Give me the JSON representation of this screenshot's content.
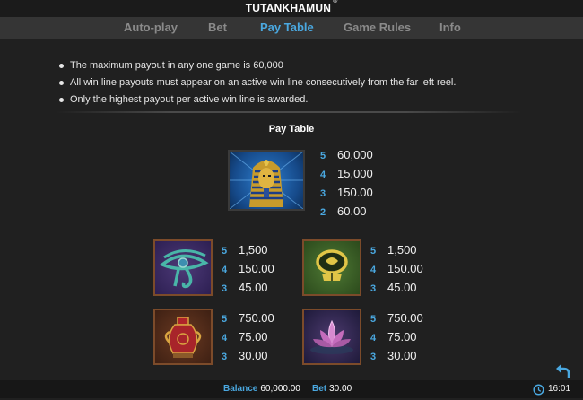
{
  "app": {
    "title": "TUTANKHAMUN",
    "mark": "®"
  },
  "tabs": [
    {
      "label": "Auto-play",
      "active": false
    },
    {
      "label": "Bet",
      "active": false
    },
    {
      "label": "Pay Table",
      "active": true
    },
    {
      "label": "Game Rules",
      "active": false
    },
    {
      "label": "Info",
      "active": false
    }
  ],
  "rules": [
    "The maximum payout in any one game is 60,000",
    "All win line payouts must appear on an active win line consecutively from the far left reel.",
    "Only the highest payout per active win line is awarded."
  ],
  "paytable": {
    "title": "Pay Table",
    "symbols": [
      {
        "icon": "pharaoh-mask-icon",
        "payouts": [
          {
            "count": "5",
            "amount": "60,000"
          },
          {
            "count": "4",
            "amount": "15,000"
          },
          {
            "count": "3",
            "amount": "150.00"
          },
          {
            "count": "2",
            "amount": "60.00"
          }
        ]
      },
      {
        "icon": "eye-of-horus-icon",
        "payouts": [
          {
            "count": "5",
            "amount": "1,500"
          },
          {
            "count": "4",
            "amount": "150.00"
          },
          {
            "count": "3",
            "amount": "45.00"
          }
        ]
      },
      {
        "icon": "scarab-amulet-icon",
        "payouts": [
          {
            "count": "5",
            "amount": "1,500"
          },
          {
            "count": "4",
            "amount": "150.00"
          },
          {
            "count": "3",
            "amount": "45.00"
          }
        ]
      },
      {
        "icon": "vase-icon",
        "payouts": [
          {
            "count": "5",
            "amount": "750.00"
          },
          {
            "count": "4",
            "amount": "75.00"
          },
          {
            "count": "3",
            "amount": "30.00"
          }
        ]
      },
      {
        "icon": "lotus-flower-icon",
        "payouts": [
          {
            "count": "5",
            "amount": "750.00"
          },
          {
            "count": "4",
            "amount": "75.00"
          },
          {
            "count": "3",
            "amount": "30.00"
          }
        ]
      }
    ]
  },
  "footer": {
    "balance_label": "Balance",
    "balance_value": "60,000.00",
    "bet_label": "Bet",
    "bet_value": "30.00",
    "time": "16:01"
  },
  "colors": {
    "accent": "#4aa8e0",
    "background": "#202020",
    "tabbar": "#353535"
  }
}
